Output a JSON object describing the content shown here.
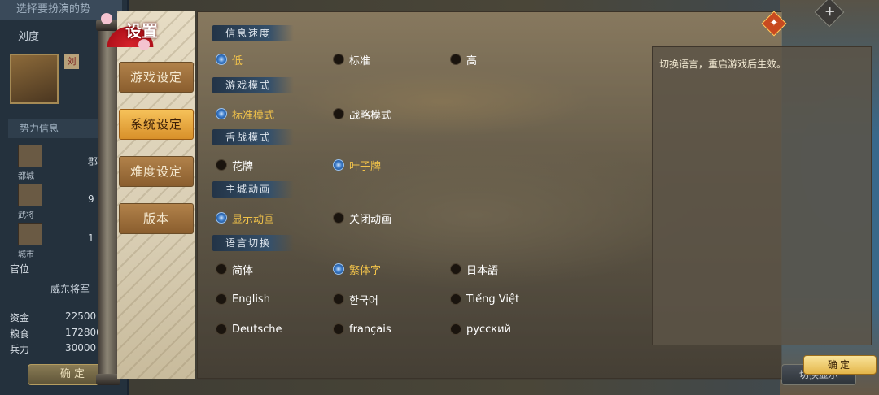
{
  "left_panel": {
    "title": "选择要扮演的势",
    "name": "刘度",
    "tag": "刘",
    "section": "势力信息",
    "stats": [
      {
        "label": "都城",
        "value": "郡"
      },
      {
        "label": "武将",
        "value": "9"
      },
      {
        "label": "城市",
        "value": "1"
      }
    ],
    "office_label": "官位",
    "office_value": "威东将军",
    "resources": [
      {
        "label": "资金",
        "value": "22500"
      },
      {
        "label": "粮食",
        "value": "172800"
      },
      {
        "label": "兵力",
        "value": "30000"
      }
    ],
    "ok_label": "确 定"
  },
  "right_button": "切换显示",
  "dialog": {
    "title": "设置",
    "nav": [
      {
        "label": "游戏设定",
        "active": false
      },
      {
        "label": "系统设定",
        "active": true
      },
      {
        "label": "难度设定",
        "active": false
      },
      {
        "label": "版本",
        "active": false
      }
    ],
    "sections": [
      {
        "header": "信息速度",
        "options": [
          {
            "label": "低",
            "selected": true
          },
          {
            "label": "标准",
            "selected": false
          },
          {
            "label": "高",
            "selected": false
          }
        ]
      },
      {
        "header": "游戏模式",
        "options": [
          {
            "label": "标准模式",
            "selected": true
          },
          {
            "label": "战略模式",
            "selected": false
          }
        ]
      },
      {
        "header": "舌战模式",
        "options": [
          {
            "label": "花牌",
            "selected": false
          },
          {
            "label": "叶子牌",
            "selected": true
          }
        ]
      },
      {
        "header": "主城动画",
        "options": [
          {
            "label": "显示动画",
            "selected": true
          },
          {
            "label": "关闭动画",
            "selected": false
          }
        ]
      },
      {
        "header": "语言切换",
        "options": [
          {
            "label": "简体",
            "selected": false
          },
          {
            "label": "繁体字",
            "selected": true
          },
          {
            "label": "日本語",
            "selected": false
          },
          {
            "label": "English",
            "selected": false
          },
          {
            "label": "한국어",
            "selected": false
          },
          {
            "label": "Tiếng Việt",
            "selected": false
          },
          {
            "label": "Deutsche",
            "selected": false
          },
          {
            "label": "français",
            "selected": false
          },
          {
            "label": "русский",
            "selected": false
          }
        ]
      }
    ],
    "info_text": "切换语言，重启游戏后生效。",
    "confirm_label": "确定",
    "close_icon": "✦"
  },
  "colors": {
    "selected_text": "#f2c34a",
    "active_tab": "#f6c25a"
  }
}
